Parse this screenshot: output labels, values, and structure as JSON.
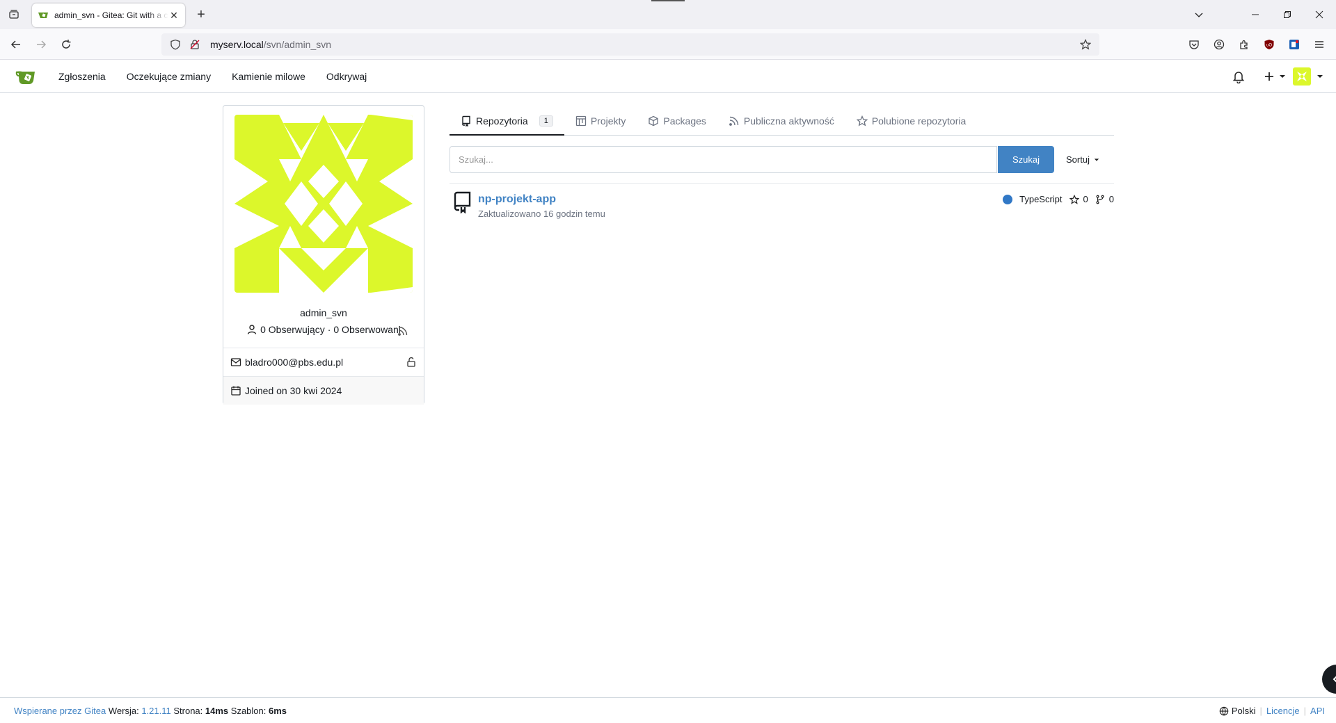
{
  "browser": {
    "tab_title": "admin_svn - Gitea: Git with a cup of tea",
    "url_host": "myserv.local",
    "url_path": "/svn/admin_svn"
  },
  "header": {
    "nav": [
      "Zgłoszenia",
      "Oczekujące zmiany",
      "Kamienie milowe",
      "Odkrywaj"
    ]
  },
  "profile": {
    "username": "admin_svn",
    "followers": "0 Obserwujący",
    "separator": "·",
    "following": "0 Obserwowani",
    "email": "bladro000@pbs.edu.pl",
    "joined": "Joined on 30 kwi 2024",
    "avatar_color": "#dcf72b"
  },
  "tabs": [
    {
      "label": "Repozytoria",
      "count": "1",
      "active": true
    },
    {
      "label": "Projekty"
    },
    {
      "label": "Packages"
    },
    {
      "label": "Publiczna aktywność"
    },
    {
      "label": "Polubione repozytoria"
    }
  ],
  "search": {
    "placeholder": "Szukaj...",
    "button": "Szukaj",
    "sort": "Sortuj"
  },
  "repos": [
    {
      "name": "np-projekt-app",
      "updated": "Zaktualizowano 16 godzin temu",
      "language": "TypeScript",
      "language_color": "#3178c6",
      "stars": "0",
      "forks": "0"
    }
  ],
  "footer": {
    "powered": "Wspierane przez Gitea",
    "version_label": "Wersja:",
    "version": "1.21.11",
    "page_label": "Strona:",
    "page_time": "14ms",
    "template_label": "Szablon:",
    "template_time": "6ms",
    "language": "Polski",
    "licenses": "Licencje",
    "api": "API"
  }
}
